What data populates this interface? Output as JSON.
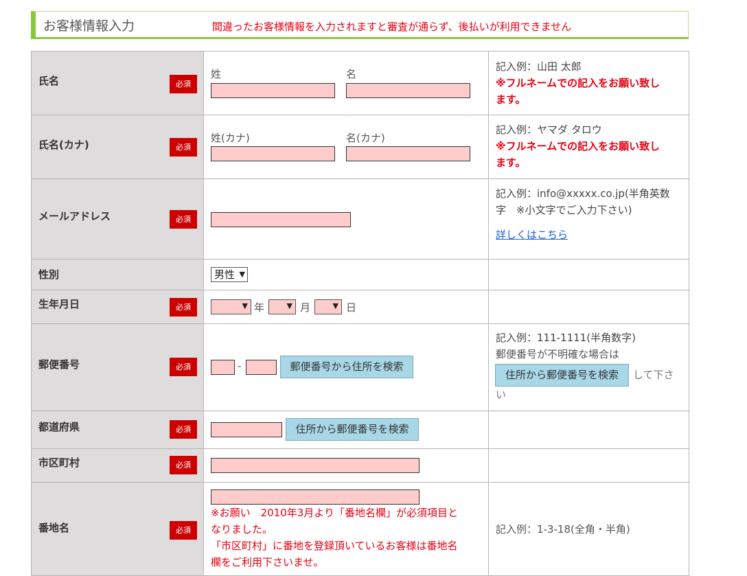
{
  "header": {
    "title": "お客様情報入力",
    "warning": "間違ったお客様情報を入力されますと審査が通らず、後払いが利用できません"
  },
  "required_label": "必須",
  "rows": {
    "name": {
      "label": "氏名",
      "last_label": "姓",
      "first_label": "名",
      "note_example": "記入例：山田 太郎",
      "note_warning_1": "※フルネームでの記入をお願い致し",
      "note_warning_2": "ます。"
    },
    "kana": {
      "label": "氏名(カナ)",
      "last_label": "姓(カナ)",
      "first_label": "名(カナ)",
      "note_example": "記入例：ヤマダ タロウ",
      "note_warning_1": "※フルネームでの記入をお願い致し",
      "note_warning_2": "ます。"
    },
    "email": {
      "label": "メールアドレス",
      "note_line1": "記入例：info@xxxxx.co.jp(半角英数",
      "note_line2": "字　※小文字でご入力下さい)",
      "link": "詳しくはこちら"
    },
    "gender": {
      "label": "性別",
      "selected": "男性"
    },
    "birthday": {
      "label": "生年月日",
      "year_unit": "年",
      "month_unit": "月",
      "day_unit": "日"
    },
    "postal": {
      "label": "郵便番号",
      "separator": "-",
      "search_button": "郵便番号から住所を検索",
      "note_line1": "記入例：111-1111(半角数字)",
      "note_line2": "郵便番号が不明確な場合は",
      "note_button": "住所から郵便番号を検索",
      "note_after": "して下さ",
      "note_line4": "い"
    },
    "prefecture": {
      "label": "都道府県",
      "search_button": "住所から郵便番号を検索"
    },
    "city": {
      "label": "市区町村"
    },
    "address": {
      "label": "番地名",
      "notice_1": "※お願い　2010年3月より「番地名欄」が必須項目と",
      "notice_2": "なりました。",
      "notice_3": "「市区町村」に番地を登録頂いているお客様は番地名",
      "notice_4": "欄をご利用下さいませ。",
      "note_example": "記入例：1-3-18(全角・半角)"
    }
  },
  "colors": {
    "accent_green": "#8cc63f",
    "required_red": "#cc0000",
    "warning_red": "#e60012",
    "input_pink": "#ffcccc",
    "label_gray": "#dedcdc",
    "button_blue": "#a8d8e8"
  }
}
